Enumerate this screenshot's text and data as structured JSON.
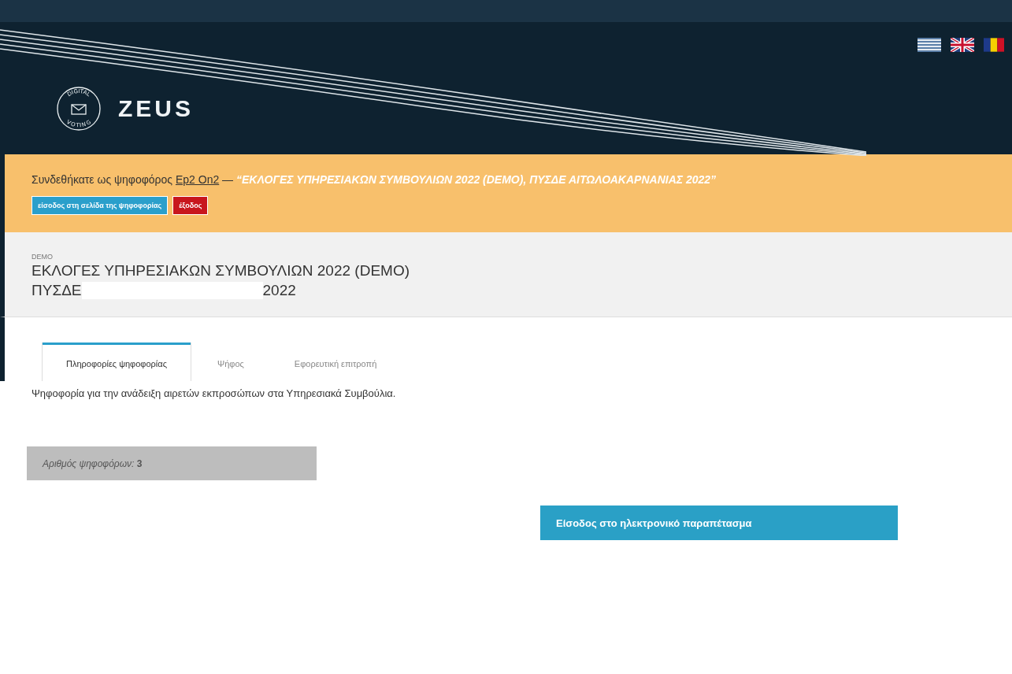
{
  "header": {
    "logo": {
      "ring_top": "DIGITAL",
      "ring_bottom": "VOTING",
      "name": "ZEUS"
    },
    "languages": [
      {
        "kind": "greek"
      },
      {
        "kind": "uk"
      },
      {
        "kind": "romania"
      }
    ]
  },
  "banner": {
    "prefix": "Συνδεθήκατε ως ψηφοφόρος",
    "voter": "Ep2 On2",
    "dash": "—",
    "election": "“ΕΚΛΟΓΕΣ ΥΠΗΡΕΣΙΑΚΩΝ ΣΥΜΒΟΥΛΙΩΝ 2022 (DEMO), ΠΥΣΔΕ ΑΙΤΩΛΟΑΚΑΡΝΑΝΙΑΣ 2022”",
    "buttons": [
      {
        "label": "είσοδος στη σελίδα της ψηφοφορίας",
        "kind": "primary"
      },
      {
        "label": "έξοδος",
        "kind": "danger"
      }
    ]
  },
  "election": {
    "tag": "DEMO",
    "title": "ΕΚΛΟΓΕΣ ΥΠΗΡΕΣΙΑΚΩΝ ΣΥΜΒΟΥΛΙΩΝ 2022 (DEMO)",
    "subtitle_start": "ΠΥΣΔΕ",
    "subtitle_end": "2022"
  },
  "tabs": [
    {
      "label": "Πληροφορίες ψηφοφορίας",
      "selected": true
    },
    {
      "label": "Ψήφος",
      "selected": false
    },
    {
      "label": "Εφορευτική επιτροπή",
      "selected": false
    }
  ],
  "description": "Ψηφοφορία για την ανάδειξη αιρετών εκπροσώπων στα Υπηρεσιακά Συμβούλια.",
  "voters": "*Αριθμός ψηφοφόρων:* **3**",
  "booth_button": "Είσοδος στο ηλεκτρονικό παραπέτασμα"
}
